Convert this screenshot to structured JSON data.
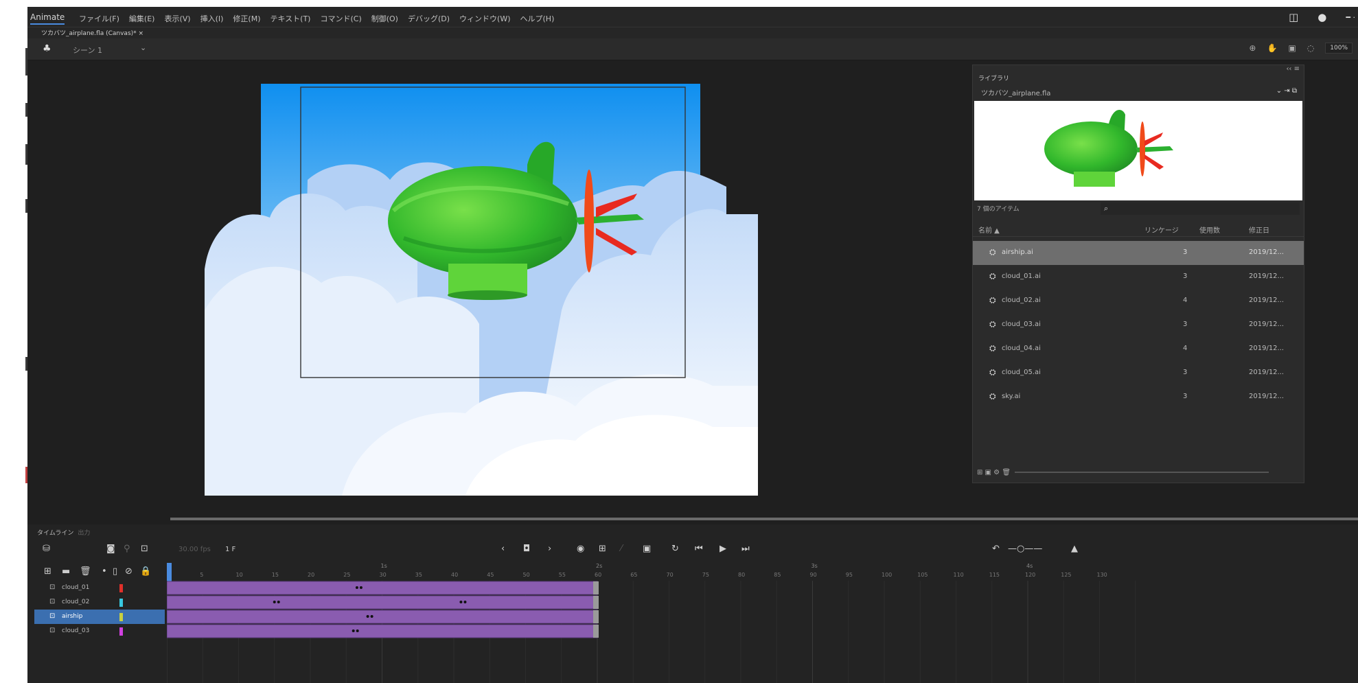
{
  "app": {
    "name": "Animate"
  },
  "menu": [
    "ファイル(F)",
    "編集(E)",
    "表示(V)",
    "挿入(I)",
    "修正(M)",
    "テキスト(T)",
    "コマンド(C)",
    "制御(O)",
    "デバッグ(D)",
    "ウィンドウ(W)",
    "ヘルプ(H)"
  ],
  "doc_tab": "ツカバツ_airplane.fla (Canvas)* ×",
  "scene": {
    "label": "シーン 1",
    "zoom": "100%"
  },
  "library": {
    "title": "ライブラリ",
    "file": "ツカバツ_airplane.fla",
    "item_count": "7 個のアイテム",
    "columns": {
      "name": "名前 ▲",
      "linkage": "リンケージ",
      "use_count": "使用数",
      "date": "修正日"
    },
    "items": [
      {
        "name": "airship.ai",
        "uses": "3",
        "date": "2019/12...",
        "selected": true
      },
      {
        "name": "cloud_01.ai",
        "uses": "3",
        "date": "2019/12..."
      },
      {
        "name": "cloud_02.ai",
        "uses": "4",
        "date": "2019/12..."
      },
      {
        "name": "cloud_03.ai",
        "uses": "3",
        "date": "2019/12..."
      },
      {
        "name": "cloud_04.ai",
        "uses": "4",
        "date": "2019/12..."
      },
      {
        "name": "cloud_05.ai",
        "uses": "3",
        "date": "2019/12..."
      },
      {
        "name": "sky.ai",
        "uses": "3",
        "date": "2019/12..."
      }
    ]
  },
  "timeline": {
    "title": "タイムライン",
    "subtitle": "出力",
    "fps": "30.00 fps",
    "frame": "1 F",
    "ruler_numbers": [
      "5",
      "10",
      "15",
      "20",
      "25",
      "30",
      "35",
      "40",
      "45",
      "50",
      "55",
      "60",
      "65",
      "70",
      "75",
      "80",
      "85",
      "90",
      "95",
      "100",
      "105",
      "110",
      "115",
      "120",
      "125",
      "130"
    ],
    "ruler_seconds": [
      "1s",
      "2s",
      "3s",
      "4s"
    ],
    "layers": [
      {
        "name": "cloud_01",
        "color": "#e0302a"
      },
      {
        "name": "cloud_02",
        "color": "#38c8e0"
      },
      {
        "name": "airship",
        "color": "#c8d040",
        "selected": true
      },
      {
        "name": "cloud_03",
        "color": "#d040e0"
      }
    ],
    "span_color": "#8a5cb0"
  }
}
